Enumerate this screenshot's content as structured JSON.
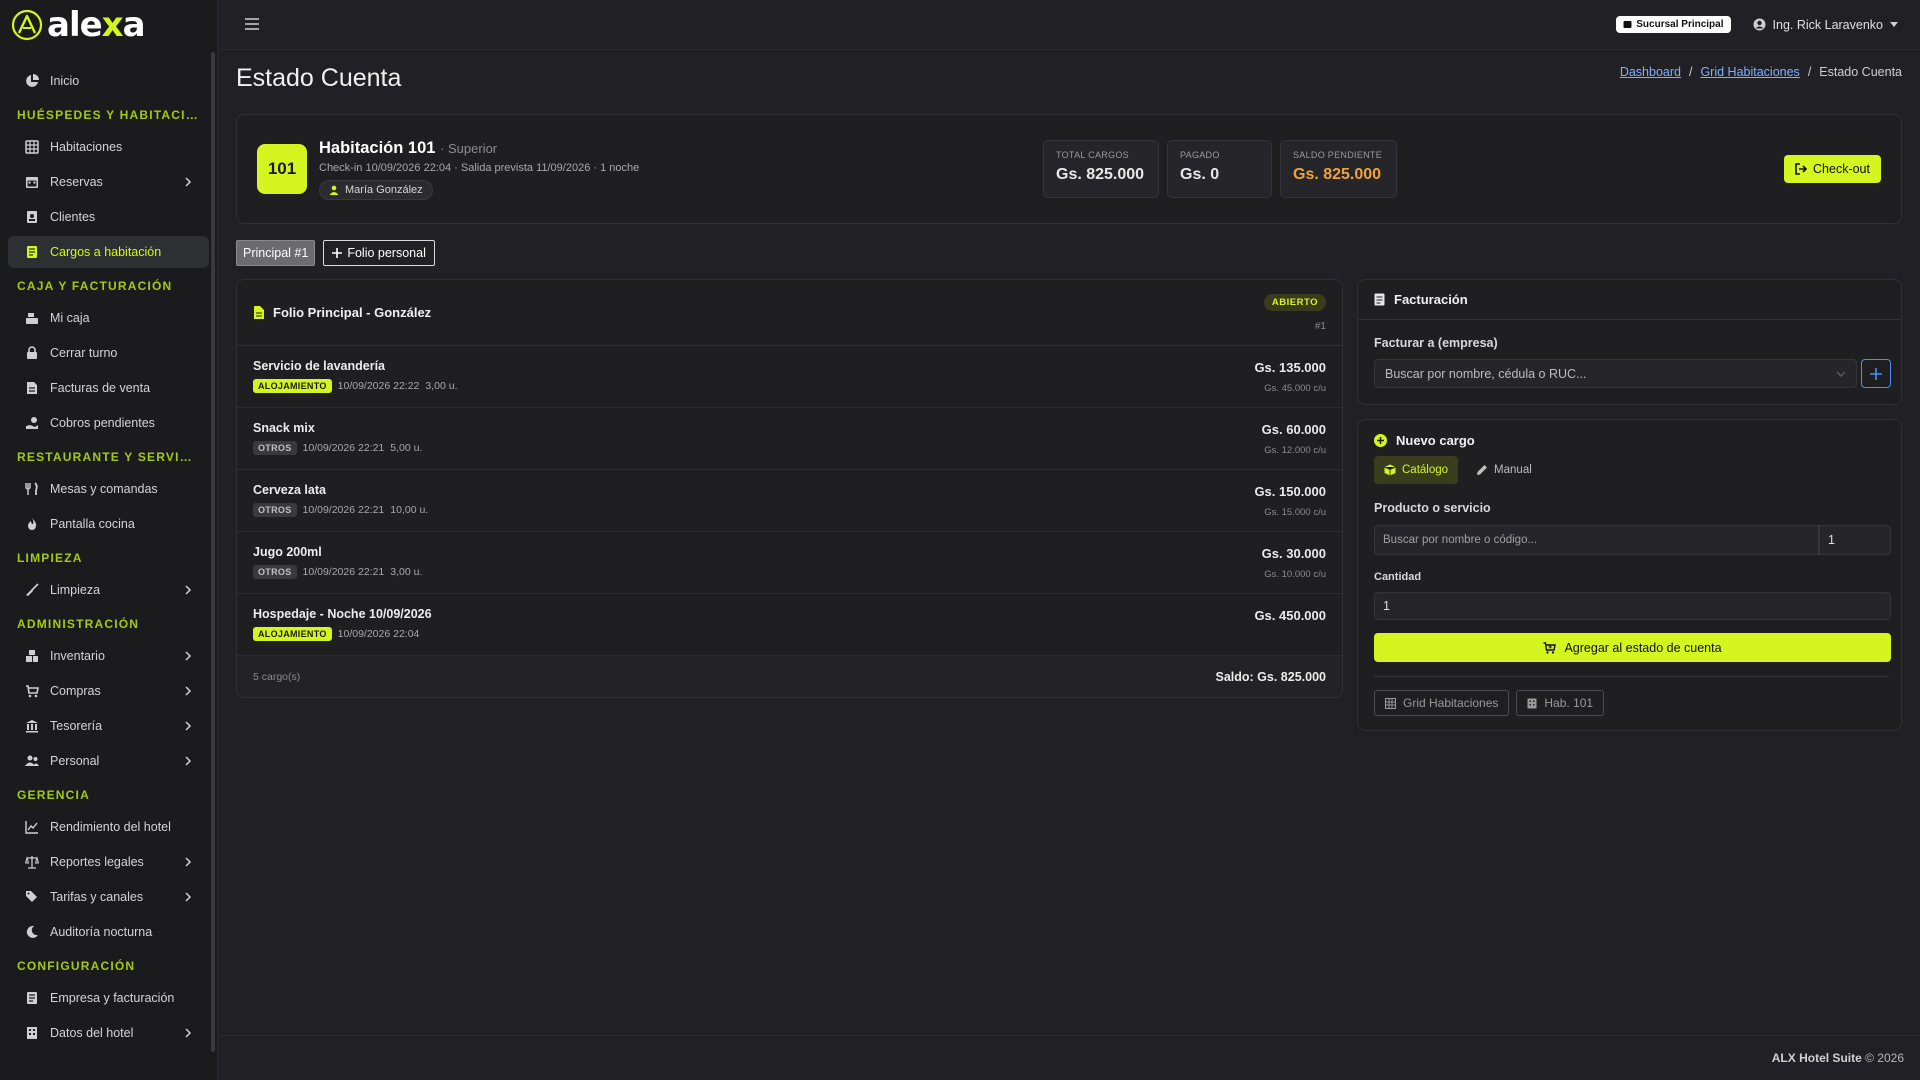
{
  "brand": {
    "name_prefix": "ale",
    "name_accent": "x",
    "name_suffix": "a",
    "accent_color": "#d4f51f"
  },
  "sidebar": {
    "home": "Inicio",
    "sections": {
      "guests": "Huéspedes y habitacio...",
      "cash": "Caja y facturación",
      "restaurant": "Restaurante y servici...",
      "cleaning": "Limpieza",
      "admin": "Administración",
      "management": "Gerencia",
      "config": "Configuración"
    },
    "items": {
      "rooms": "Habitaciones",
      "reservations": "Reservas",
      "clients": "Clientes",
      "room_charges": "Cargos a habitación",
      "my_cash": "Mi caja",
      "close_shift": "Cerrar turno",
      "sales_invoices": "Facturas de venta",
      "pending_payments": "Cobros pendientes",
      "tables_orders": "Mesas y comandas",
      "kitchen_screen": "Pantalla cocina",
      "cleaning": "Limpieza",
      "inventory": "Inventario",
      "purchases": "Compras",
      "treasury": "Tesorería",
      "staff": "Personal",
      "hotel_performance": "Rendimiento del hotel",
      "legal_reports": "Reportes legales",
      "rates_channels": "Tarifas y canales",
      "night_audit": "Auditoría nocturna",
      "company_billing": "Empresa y facturación",
      "hotel_data": "Datos del hotel"
    }
  },
  "topbar": {
    "branch": "Sucursal Principal",
    "user": "Ing. Rick Laravenko"
  },
  "page": {
    "title": "Estado Cuenta",
    "breadcrumb": [
      "Dashboard",
      "Grid Habitaciones",
      "Estado Cuenta"
    ]
  },
  "room": {
    "number": "101",
    "title": "Habitación 101",
    "type": "· Superior",
    "dates": "Check-in 10/09/2026 22:04 · Salida prevista 11/09/2026 · 1 noche",
    "guest": "María González",
    "stats": {
      "total_label": "Total cargos",
      "total_value": "Gs. 825.000",
      "paid_label": "Pagado",
      "paid_value": "Gs. 0",
      "pending_label": "Saldo pendiente",
      "pending_value": "Gs. 825.000"
    },
    "checkout_label": "Check-out"
  },
  "folio_tabs": {
    "principal": "Principal #1",
    "personal": "Folio personal"
  },
  "folio": {
    "title": "Folio Principal - González",
    "status": "ABIERTO",
    "number": "#1",
    "charges": [
      {
        "name": "Servicio de lavandería",
        "tag": "ALOJAMIENTO",
        "datetime": "10/09/2026 22:22",
        "qty": "3,00 u.",
        "amount": "Gs. 135.000",
        "unit_price": "Gs. 45.000 c/u"
      },
      {
        "name": "Snack mix",
        "tag": "OTROS",
        "datetime": "10/09/2026 22:21",
        "qty": "5,00 u.",
        "amount": "Gs. 60.000",
        "unit_price": "Gs. 12.000 c/u"
      },
      {
        "name": "Cerveza lata",
        "tag": "OTROS",
        "datetime": "10/09/2026 22:21",
        "qty": "10,00 u.",
        "amount": "Gs. 150.000",
        "unit_price": "Gs. 15.000 c/u"
      },
      {
        "name": "Jugo 200ml",
        "tag": "OTROS",
        "datetime": "10/09/2026 22:21",
        "qty": "3,00 u.",
        "amount": "Gs. 30.000",
        "unit_price": "Gs. 10.000 c/u"
      },
      {
        "name": "Hospedaje - Noche 10/09/2026",
        "tag": "ALOJAMIENTO",
        "datetime": "10/09/2026 22:04",
        "qty": "",
        "amount": "Gs. 450.000",
        "unit_price": ""
      }
    ],
    "count": "5 cargo(s)",
    "balance": "Saldo: Gs. 825.000"
  },
  "billing": {
    "title": "Facturación",
    "label": "Facturar a (empresa)",
    "placeholder": "Buscar por nombre, cédula o RUC..."
  },
  "new_charge": {
    "title": "Nuevo cargo",
    "tab_catalog": "Catálogo",
    "tab_manual": "Manual",
    "product_label": "Producto o servicio",
    "product_placeholder": "Buscar por nombre o código...",
    "product_qty": "1",
    "qty_label": "Cantidad",
    "qty_value": "1",
    "add_button": "Agregar al estado de cuenta",
    "link_grid": "Grid Habitaciones",
    "link_room": "Hab. 101"
  },
  "footer": {
    "product": "ALX Hotel Suite",
    "copyright": "© 2026"
  }
}
